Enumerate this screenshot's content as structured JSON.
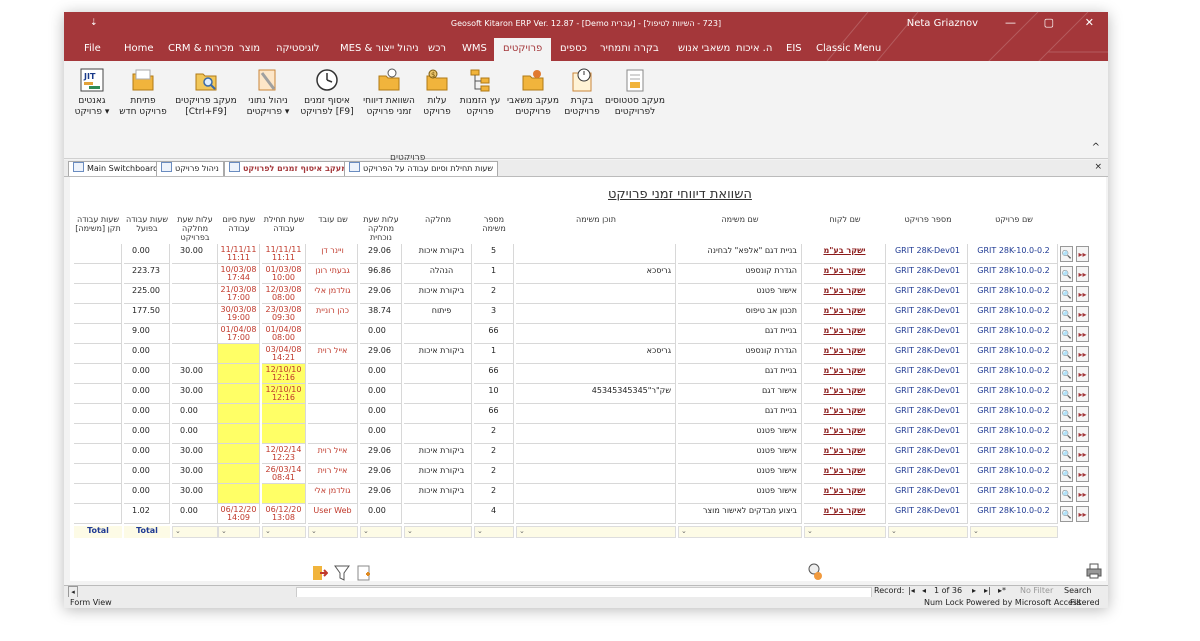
{
  "titlebar": {
    "qat": "⇣",
    "title": "Geosoft Kitaron ERP Ver. 12.87 - [Demo עברית] - [723 - השיוות לטיפול]",
    "user": "Neta Griaznov",
    "minimize": "—",
    "restore": "▢",
    "close": "✕"
  },
  "tabs": [
    "File",
    "Home",
    "CRM & מכירות",
    "מוצר",
    "לוגיסטיקה",
    "MES & ניהול ייצור",
    "רכש",
    "WMS",
    "פרויקטים",
    "כספים",
    "בקרה ותמחיר",
    "משאבי אנוש",
    "ה. איכות",
    "EIS",
    "Classic Menu"
  ],
  "ribbon": {
    "buttons": [
      {
        "icon": "gantt-icon",
        "l1": "גאנטים",
        "l2": "פרויקט ▾"
      },
      {
        "icon": "folder-icon",
        "l1": "פתיחת",
        "l2": "פרויקט חדש"
      },
      {
        "icon": "folder-search-icon",
        "l1": "מעקב פרויקטים",
        "l2": "[Ctrl+F9]"
      },
      {
        "icon": "data-mgmt-icon",
        "l1": "ניהול נתוני",
        "l2": "פרויקטים ▾"
      },
      {
        "icon": "clock-icon",
        "l1": "איסוף זמנים",
        "l2": "לפרויקט [F9]"
      },
      {
        "icon": "report-icon",
        "l1": "השוואת דיווחי",
        "l2": "זמני פרויקט"
      },
      {
        "icon": "cost-icon",
        "l1": "עלות",
        "l2": "פרויקט"
      },
      {
        "icon": "tree-icon",
        "l1": "עץ הזמנות",
        "l2": "פרויקט"
      },
      {
        "icon": "resources-icon",
        "l1": "מעקב משאבי",
        "l2": "פרויקטים"
      },
      {
        "icon": "control-icon",
        "l1": "בקרת",
        "l2": "פרויקטים"
      },
      {
        "icon": "status-icon",
        "l1": "מעקב סטטוסים",
        "l2": "לפרויקטים"
      }
    ],
    "group_label": "פרויקטים",
    "collapse": "^"
  },
  "doc_tabs": [
    "Main Switchboard",
    "ניהול פרויקט",
    "מעקב איסוף זמנים לפרויקט",
    "שעות תחילת וסיום עבודה על הפרויקט"
  ],
  "doc_close": "×",
  "form": {
    "title": "השוואת דיווחי זמני פרויקט",
    "headers": {
      "std_hours": "שעות עבודה תקן [משימה]",
      "actual_hours": "שעות עבודה בפועל",
      "dept_cost": "עלות שעת מחלקה בפרויקט",
      "end_time": "שעת סיום עבודה",
      "start_time": "שעת תחילת עבודה",
      "worker": "שם עובד",
      "curr_cost": "עלות שעת מחלקה נוכחית",
      "dept": "מחלקה",
      "task_no": "מספר משימה",
      "task_content": "תוכן משימה",
      "task_name": "שם משימה",
      "customer": "שם לקוח",
      "project_no": "מספר פרויקט",
      "project_name": "שם פרויקט"
    },
    "rows": [
      {
        "std": "",
        "act": "0.00",
        "dcost": "30.00",
        "end": "11/11/11",
        "end2": "11:11",
        "start": "11/11/11",
        "start2": "11:11",
        "worker": "ויינר דן",
        "cost": "29.06",
        "dept": "ביקורת איכות",
        "tno": "5",
        "content": "",
        "tname": "בניית דגם \"אלפא\" לבחינה",
        "cust": "ישקר בע\"מ",
        "pno": "GRIT 28K-Dev01",
        "pname": "GRIT 28K-10.0-0.2",
        "ye": false,
        "ys": false
      },
      {
        "std": "",
        "act": "223.73",
        "dcost": "",
        "end": "10/03/08",
        "end2": "17:44",
        "start": "01/03/08",
        "start2": "10:00",
        "worker": "גבעתי רונן",
        "cost": "96.86",
        "dept": "הנהלה",
        "tno": "1",
        "content": "גריסכא",
        "tname": "הגדרת קונספט",
        "cust": "ישקר בע\"מ",
        "pno": "GRIT 28K-Dev01",
        "pname": "GRIT 28K-10.0-0.2",
        "ye": false,
        "ys": false
      },
      {
        "std": "",
        "act": "225.00",
        "dcost": "",
        "end": "21/03/08",
        "end2": "17:00",
        "start": "12/03/08",
        "start2": "08:00",
        "worker": "גולדמן אלי",
        "cost": "29.06",
        "dept": "ביקורת איכות",
        "tno": "2",
        "content": "",
        "tname": "אישור פטנט",
        "cust": "ישקר בע\"מ",
        "pno": "GRIT 28K-Dev01",
        "pname": "GRIT 28K-10.0-0.2",
        "ye": false,
        "ys": false
      },
      {
        "std": "",
        "act": "177.50",
        "dcost": "",
        "end": "30/03/08",
        "end2": "19:00",
        "start": "23/03/08",
        "start2": "09:30",
        "worker": "כהן רוניית",
        "cost": "38.74",
        "dept": "פיתוח",
        "tno": "3",
        "content": "",
        "tname": "תכנון אב טיפוס",
        "cust": "ישקר בע\"מ",
        "pno": "GRIT 28K-Dev01",
        "pname": "GRIT 28K-10.0-0.2",
        "ye": false,
        "ys": false
      },
      {
        "std": "",
        "act": "9.00",
        "dcost": "",
        "end": "01/04/08",
        "end2": "17:00",
        "start": "01/04/08",
        "start2": "08:00",
        "worker": "",
        "cost": "0.00",
        "dept": "",
        "tno": "66",
        "content": "",
        "tname": "בניית דגם",
        "cust": "ישקר בע\"מ",
        "pno": "GRIT 28K-Dev01",
        "pname": "GRIT 28K-10.0-0.2",
        "ye": false,
        "ys": false
      },
      {
        "std": "",
        "act": "0.00",
        "dcost": "",
        "end": "",
        "end2": "",
        "start": "03/04/08",
        "start2": "14:21",
        "worker": "אייל רוית",
        "cost": "29.06",
        "dept": "ביקורת איכות",
        "tno": "1",
        "content": "גריסכא",
        "tname": "הגדרת קונספט",
        "cust": "ישקר בע\"מ",
        "pno": "GRIT 28K-Dev01",
        "pname": "GRIT 28K-10.0-0.2",
        "ye": true,
        "ys": false
      },
      {
        "std": "",
        "act": "0.00",
        "dcost": "30.00",
        "end": "",
        "end2": "",
        "start": "12/10/10",
        "start2": "12:16",
        "worker": "",
        "cost": "0.00",
        "dept": "",
        "tno": "66",
        "content": "",
        "tname": "בניית דגם",
        "cust": "ישקר בע\"מ",
        "pno": "GRIT 28K-Dev01",
        "pname": "GRIT 28K-10.0-0.2",
        "ye": true,
        "ys": true
      },
      {
        "std": "",
        "act": "0.00",
        "dcost": "30.00",
        "end": "",
        "end2": "",
        "start": "12/10/10",
        "start2": "12:16",
        "worker": "",
        "cost": "0.00",
        "dept": "",
        "tno": "10",
        "content": "שק\"ר\"45345345345",
        "tname": "אישור דגם",
        "cust": "ישקר בע\"מ",
        "pno": "GRIT 28K-Dev01",
        "pname": "GRIT 28K-10.0-0.2",
        "ye": true,
        "ys": true
      },
      {
        "std": "",
        "act": "0.00",
        "dcost": "0.00",
        "end": "",
        "end2": "",
        "start": "",
        "start2": "",
        "worker": "",
        "cost": "0.00",
        "dept": "",
        "tno": "66",
        "content": "",
        "tname": "בניית דגם",
        "cust": "ישקר בע\"מ",
        "pno": "GRIT 28K-Dev01",
        "pname": "GRIT 28K-10.0-0.2",
        "ye": true,
        "ys": true
      },
      {
        "std": "",
        "act": "0.00",
        "dcost": "0.00",
        "end": "",
        "end2": "",
        "start": "",
        "start2": "",
        "worker": "",
        "cost": "0.00",
        "dept": "",
        "tno": "2",
        "content": "",
        "tname": "אישור פטנט",
        "cust": "ישקר בע\"מ",
        "pno": "GRIT 28K-Dev01",
        "pname": "GRIT 28K-10.0-0.2",
        "ye": true,
        "ys": true
      },
      {
        "std": "",
        "act": "0.00",
        "dcost": "30.00",
        "end": "",
        "end2": "",
        "start": "12/02/14",
        "start2": "12:23",
        "worker": "אייל רוית",
        "cost": "29.06",
        "dept": "ביקורת איכות",
        "tno": "2",
        "content": "",
        "tname": "אישור פטנט",
        "cust": "ישקר בע\"מ",
        "pno": "GRIT 28K-Dev01",
        "pname": "GRIT 28K-10.0-0.2",
        "ye": true,
        "ys": false
      },
      {
        "std": "",
        "act": "0.00",
        "dcost": "30.00",
        "end": "",
        "end2": "",
        "start": "26/03/14",
        "start2": "08:41",
        "worker": "אייל רוית",
        "cost": "29.06",
        "dept": "ביקורת איכות",
        "tno": "2",
        "content": "",
        "tname": "אישור פטנט",
        "cust": "ישקר בע\"מ",
        "pno": "GRIT 28K-Dev01",
        "pname": "GRIT 28K-10.0-0.2",
        "ye": true,
        "ys": false
      },
      {
        "std": "",
        "act": "0.00",
        "dcost": "30.00",
        "end": "",
        "end2": "",
        "start": "",
        "start2": "",
        "worker": "גולדמן אלי",
        "cost": "29.06",
        "dept": "ביקורת איכות",
        "tno": "2",
        "content": "",
        "tname": "אישור פטנט",
        "cust": "ישקר בע\"מ",
        "pno": "GRIT 28K-Dev01",
        "pname": "GRIT 28K-10.0-0.2",
        "ye": true,
        "ys": true
      },
      {
        "std": "",
        "act": "1.02",
        "dcost": "0.00",
        "end": "06/12/20",
        "end2": "14:09",
        "start": "06/12/20",
        "start2": "13:08",
        "worker": "User Web",
        "cost": "0.00",
        "dept": "",
        "tno": "4",
        "content": "",
        "tname": "ביצוע מבדקים לאישור מוצר",
        "cust": "ישקר בע\"מ",
        "pno": "GRIT 28K-Dev01",
        "pname": "GRIT 28K-10.0-0.2",
        "ye": false,
        "ys": false
      }
    ],
    "total_label": "Total",
    "total_value": "Total",
    "row_search": "🔍",
    "row_go": "▸▸"
  },
  "nav": {
    "record_label": "Record:",
    "record_of": "1 of 36",
    "first": "|◂",
    "prev": "◂",
    "next": "▸",
    "last": "▸|",
    "new": "▸*",
    "filter": "No Filter",
    "search": "Search"
  },
  "status": {
    "left": "Form View",
    "numlock": "Num Lock",
    "powered": "Powered by Microsoft Access",
    "filtered": "Filtered"
  },
  "colors": {
    "brand": "#a4373a",
    "highlight": "#ffff66"
  }
}
